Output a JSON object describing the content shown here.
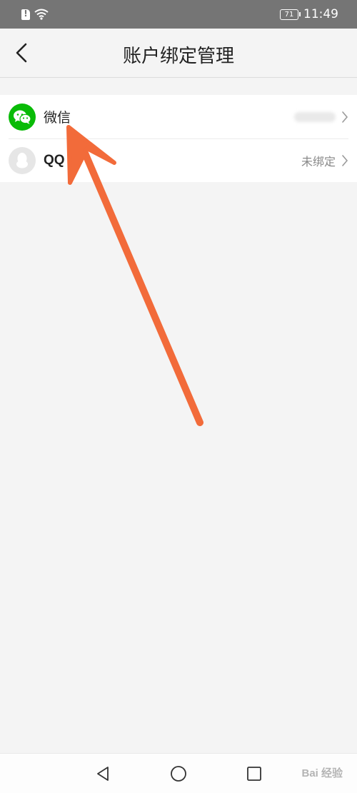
{
  "status_bar": {
    "battery_level": "71",
    "time": "11:49"
  },
  "header": {
    "title": "账户绑定管理"
  },
  "accounts": [
    {
      "label": "微信",
      "status": "",
      "icon": "wechat-icon",
      "color": "#09bb07"
    },
    {
      "label": "QQ",
      "status": "未绑定",
      "icon": "qq-icon",
      "color": "#e6e6e6"
    }
  ],
  "navbar": {
    "buttons": [
      "back-triangle-icon",
      "home-circle-icon",
      "recents-square-icon"
    ]
  },
  "annotation": {
    "color": "#f26b3a"
  },
  "watermark": {
    "text": "Bai 经验"
  }
}
